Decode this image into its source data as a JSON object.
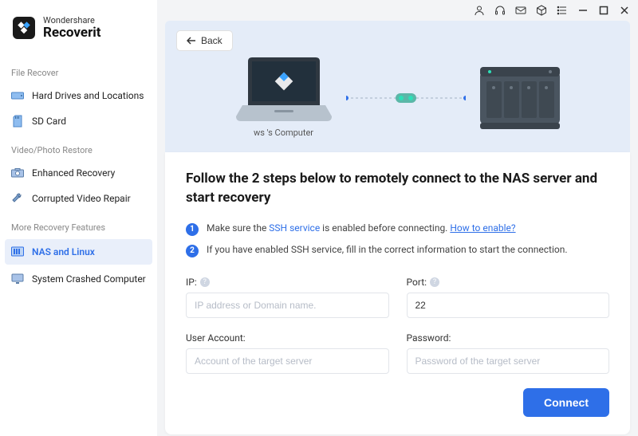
{
  "brand": {
    "line1": "Wondershare",
    "line2": "Recoverit"
  },
  "sidebar": {
    "sections": [
      {
        "title": "File Recover",
        "items": [
          {
            "id": "hard-drives",
            "label": "Hard Drives and Locations",
            "icon": "drive"
          },
          {
            "id": "sd-card",
            "label": "SD Card",
            "icon": "sd"
          }
        ]
      },
      {
        "title": "Video/Photo Restore",
        "items": [
          {
            "id": "enhanced-recovery",
            "label": "Enhanced Recovery",
            "icon": "camera"
          },
          {
            "id": "corrupted-video",
            "label": "Corrupted Video Repair",
            "icon": "wrench"
          }
        ]
      },
      {
        "title": "More Recovery Features",
        "items": [
          {
            "id": "nas-linux",
            "label": "NAS and Linux",
            "icon": "nas",
            "active": true
          },
          {
            "id": "crashed-computer",
            "label": "System Crashed Computer",
            "icon": "monitor"
          }
        ]
      }
    ]
  },
  "back_label": "Back",
  "diagram_label": "ws 's Computer",
  "heading": "Follow the 2 steps below to remotely connect to the NAS server and start recovery",
  "steps": [
    {
      "num": "1",
      "pre": "Make sure the ",
      "link1_text": "SSH service",
      "mid": " is enabled before connecting. ",
      "link2_text": "How to enable?"
    },
    {
      "num": "2",
      "text": "If you have enabled SSH service, fill in the correct information to start the connection."
    }
  ],
  "form": {
    "ip": {
      "label": "IP:",
      "placeholder": "IP address or Domain name.",
      "value": ""
    },
    "port": {
      "label": "Port:",
      "placeholder": "",
      "value": "22"
    },
    "user": {
      "label": "User Account:",
      "placeholder": "Account of the target server",
      "value": ""
    },
    "password": {
      "label": "Password:",
      "placeholder": "Password of the target server",
      "value": ""
    }
  },
  "connect_label": "Connect",
  "colors": {
    "accent": "#2e6fe8"
  }
}
